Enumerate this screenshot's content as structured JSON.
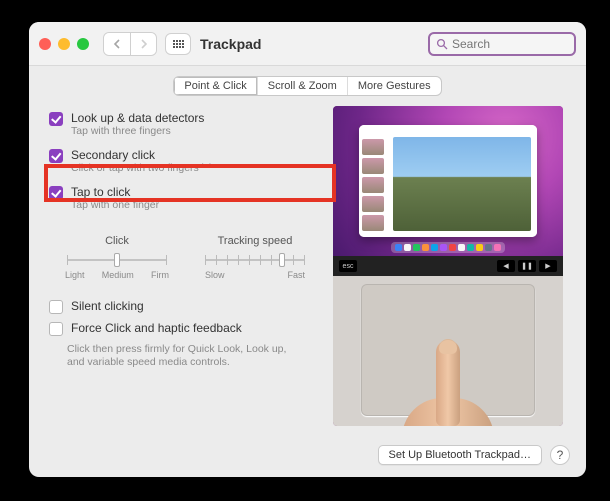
{
  "window": {
    "title": "Trackpad"
  },
  "search": {
    "placeholder": "Search"
  },
  "tabs": [
    {
      "label": "Point & Click",
      "active": true
    },
    {
      "label": "Scroll & Zoom",
      "active": false
    },
    {
      "label": "More Gestures",
      "active": false
    }
  ],
  "options": {
    "lookup": {
      "title": "Look up & data detectors",
      "sub": "Tap with three fingers",
      "checked": true,
      "dropdown": false
    },
    "secondary": {
      "title": "Secondary click",
      "sub": "Click or tap with two fingers",
      "checked": true,
      "dropdown": true
    },
    "tap": {
      "title": "Tap to click",
      "sub": "Tap with one finger",
      "checked": true,
      "dropdown": false,
      "highlighted": true
    }
  },
  "sliders": {
    "click": {
      "label": "Click",
      "marks": [
        "Light",
        "Medium",
        "Firm"
      ],
      "value_index": 1,
      "count": 3
    },
    "tracking": {
      "label": "Tracking speed",
      "marks": [
        "Slow",
        "Fast"
      ],
      "value_index": 7,
      "count": 10
    }
  },
  "options2": {
    "silent": {
      "title": "Silent clicking",
      "checked": false
    },
    "forceclick": {
      "title": "Force Click and haptic feedback",
      "checked": false,
      "hint": "Click then press firmly for Quick Look, Look up, and variable speed media controls."
    }
  },
  "bottom": {
    "setup": "Set Up Bluetooth Trackpad…",
    "help": "?"
  },
  "keys": {
    "esc": "esc"
  }
}
